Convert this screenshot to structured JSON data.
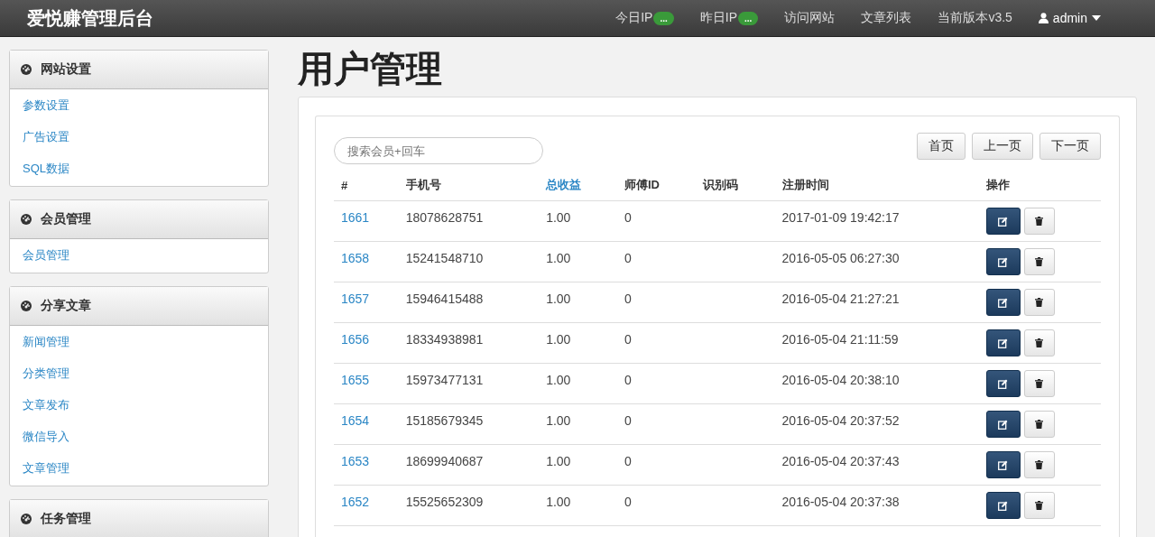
{
  "navbar": {
    "brand": "爱悦赚管理后台",
    "items": [
      {
        "label": "今日IP",
        "badge": "..."
      },
      {
        "label": "昨日IP",
        "badge": "..."
      },
      {
        "label": "访问网站"
      },
      {
        "label": "文章列表"
      },
      {
        "label": "当前版本v3.5"
      }
    ],
    "user": "admin"
  },
  "sidebar": [
    {
      "title": "网站设置",
      "items": [
        "参数设置",
        "广告设置",
        "SQL数据"
      ]
    },
    {
      "title": "会员管理",
      "items": [
        "会员管理"
      ]
    },
    {
      "title": "分享文章",
      "items": [
        "新闻管理",
        "分类管理",
        "文章发布",
        "微信导入",
        "文章管理"
      ]
    },
    {
      "title": "任务管理"
    }
  ],
  "page_title": "用户管理",
  "search": {
    "placeholder": "搜索会员+回车"
  },
  "pager": [
    "首页",
    "上一页",
    "下一页"
  ],
  "table": {
    "columns": [
      {
        "label": "#",
        "selected": false
      },
      {
        "label": "手机号",
        "selected": false
      },
      {
        "label": "总收益",
        "selected": true
      },
      {
        "label": "师傅ID",
        "selected": false
      },
      {
        "label": "识别码",
        "selected": false
      },
      {
        "label": "注册时间",
        "selected": false
      },
      {
        "label": "操作",
        "selected": false
      }
    ],
    "rows": [
      {
        "id": "1661",
        "phone": "18078628751",
        "earnings": "1.00",
        "master_id": "0",
        "code": "",
        "registered": "2017-01-09 19:42:17"
      },
      {
        "id": "1658",
        "phone": "15241548710",
        "earnings": "1.00",
        "master_id": "0",
        "code": "",
        "registered": "2016-05-05 06:27:30"
      },
      {
        "id": "1657",
        "phone": "15946415488",
        "earnings": "1.00",
        "master_id": "0",
        "code": "",
        "registered": "2016-05-04 21:27:21"
      },
      {
        "id": "1656",
        "phone": "18334938981",
        "earnings": "1.00",
        "master_id": "0",
        "code": "",
        "registered": "2016-05-04 21:11:59"
      },
      {
        "id": "1655",
        "phone": "15973477131",
        "earnings": "1.00",
        "master_id": "0",
        "code": "",
        "registered": "2016-05-04 20:38:10"
      },
      {
        "id": "1654",
        "phone": "15185679345",
        "earnings": "1.00",
        "master_id": "0",
        "code": "",
        "registered": "2016-05-04 20:37:52"
      },
      {
        "id": "1653",
        "phone": "18699940687",
        "earnings": "1.00",
        "master_id": "0",
        "code": "",
        "registered": "2016-05-04 20:37:43"
      },
      {
        "id": "1652",
        "phone": "15525652309",
        "earnings": "1.00",
        "master_id": "0",
        "code": "",
        "registered": "2016-05-04 20:37:38"
      }
    ]
  }
}
